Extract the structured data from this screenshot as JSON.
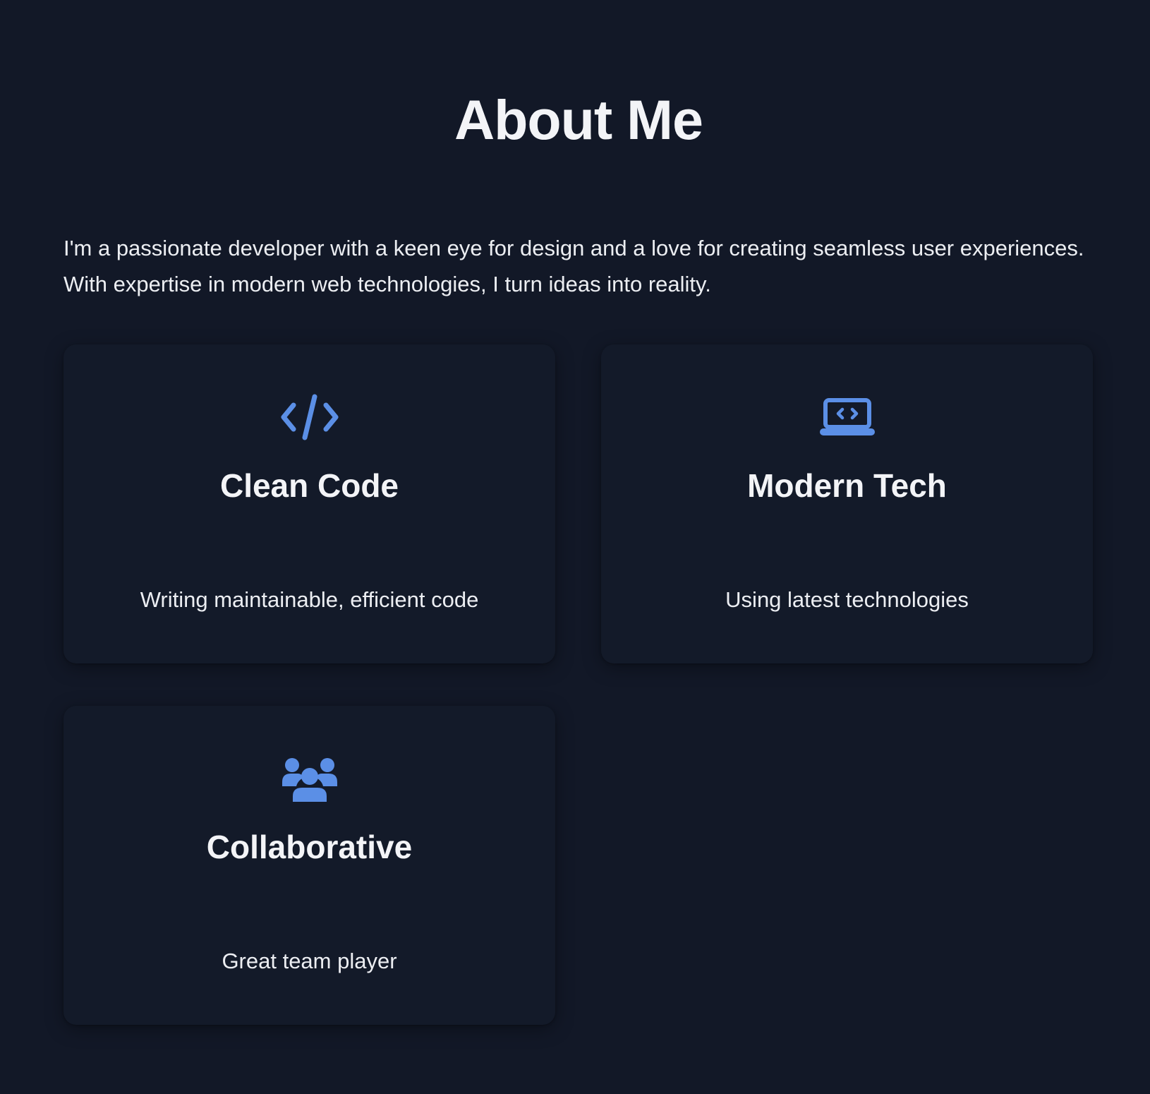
{
  "section": {
    "title": "About Me",
    "intro": "I'm a passionate developer with a keen eye for design and a love for creating seamless user experiences. With expertise in modern web technologies, I turn ideas into reality."
  },
  "accent_color": "#5b8fe6",
  "cards": [
    {
      "icon": "code-icon",
      "title": "Clean Code",
      "description": "Writing maintainable, efficient code"
    },
    {
      "icon": "laptop-code-icon",
      "title": "Modern Tech",
      "description": "Using latest technologies"
    },
    {
      "icon": "users-icon",
      "title": "Collaborative",
      "description": "Great team player"
    }
  ]
}
